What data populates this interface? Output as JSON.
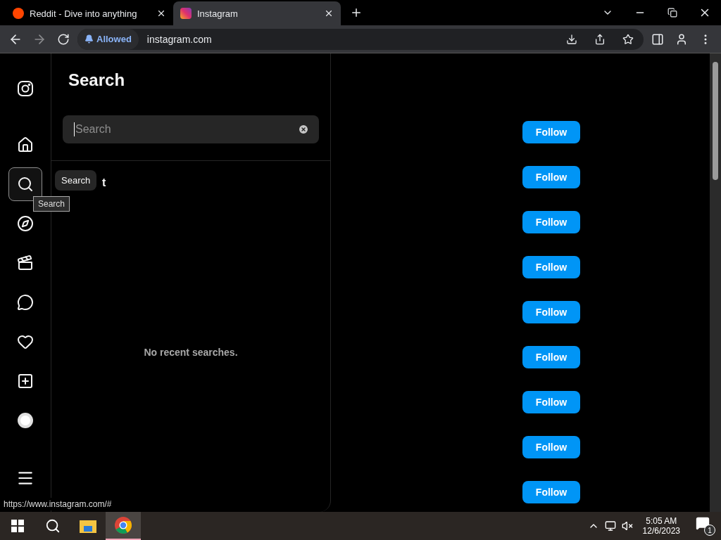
{
  "browser_tabs": [
    {
      "title": "Reddit - Dive into anything",
      "kind": "reddit",
      "selected": false
    },
    {
      "title": "Instagram",
      "kind": "instagram",
      "selected": true
    }
  ],
  "address_bar": {
    "permission": "Allowed",
    "url": "instagram.com"
  },
  "nav_items": [
    {
      "selected": false
    },
    {
      "selected": false
    },
    {
      "selected": true
    },
    {
      "selected": false
    },
    {
      "selected": false
    },
    {
      "selected": false
    },
    {
      "selected": false
    },
    {
      "selected": false
    },
    {
      "selected": false
    }
  ],
  "search_panel": {
    "title": "Search",
    "placeholder": "Search",
    "recent_heading": "t",
    "empty_message": "No recent searches."
  },
  "tooltip": "Search",
  "native_tooltip": "Search",
  "follow_buttons": [
    "Follow",
    "Follow",
    "Follow",
    "Follow",
    "Follow",
    "Follow",
    "Follow",
    "Follow",
    "Follow"
  ],
  "status_url": "https://www.instagram.com/#",
  "taskbar": {
    "time": "5:05 AM",
    "date": "12/6/2023",
    "notifications": "1"
  }
}
